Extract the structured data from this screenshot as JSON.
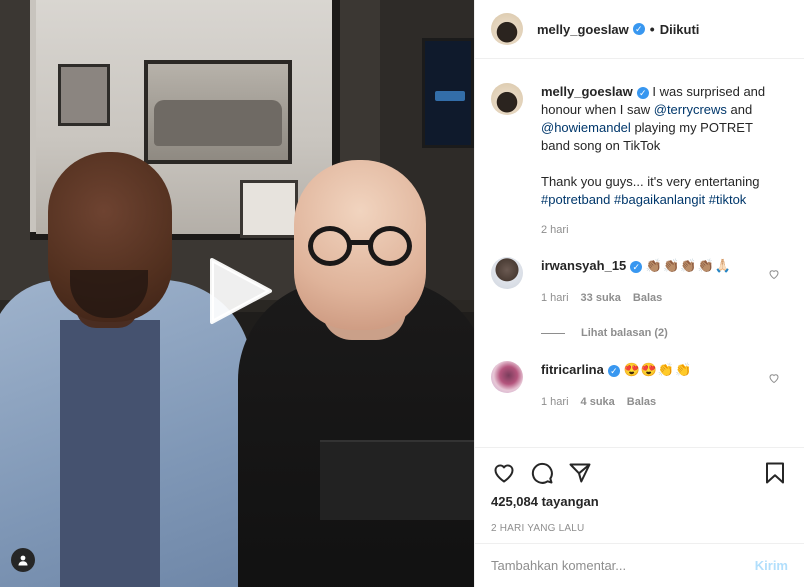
{
  "header": {
    "username": "melly_goeslaw",
    "separator": "•",
    "follow_label": "Diikuti"
  },
  "caption": {
    "username": "melly_goeslaw",
    "text_1": "I was surprised and honour when I saw",
    "mention_1": "@terrycrews",
    "text_2": "and",
    "mention_2": "@howiemandel",
    "text_3": "playing my POTRET band song on TikTok",
    "text_4": "Thank you guys... it's very entertaning",
    "hashtags": [
      "#potretband",
      "#bagaikanlangit",
      "#tiktok"
    ],
    "time": "2 hari"
  },
  "comments": [
    {
      "username": "irwansyah_15",
      "text": "👏🏽👏🏽👏🏽👏🏽🙏🏻",
      "time": "1 hari",
      "likes": "33 suka",
      "reply_label": "Balas",
      "view_replies": "Lihat balasan (2)"
    },
    {
      "username": "fitricarlina",
      "text": "😍😍👏👏",
      "time": "1 hari",
      "likes": "4 suka",
      "reply_label": "Balas"
    }
  ],
  "stats": {
    "views": "425,084 tayangan",
    "posted": "2 HARI YANG LALU"
  },
  "comment_box": {
    "placeholder": "Tambahkan komentar...",
    "post_label": "Kirim"
  },
  "icons": {
    "like": "heart-icon",
    "comment": "comment-icon",
    "share": "share-icon",
    "save": "bookmark-icon",
    "play": "play-icon",
    "verified": "verified-badge-icon"
  },
  "colors": {
    "link": "#00376b",
    "verified": "#3897f0",
    "muted": "#8e8e8e",
    "post_disabled": "#b2dffc"
  }
}
